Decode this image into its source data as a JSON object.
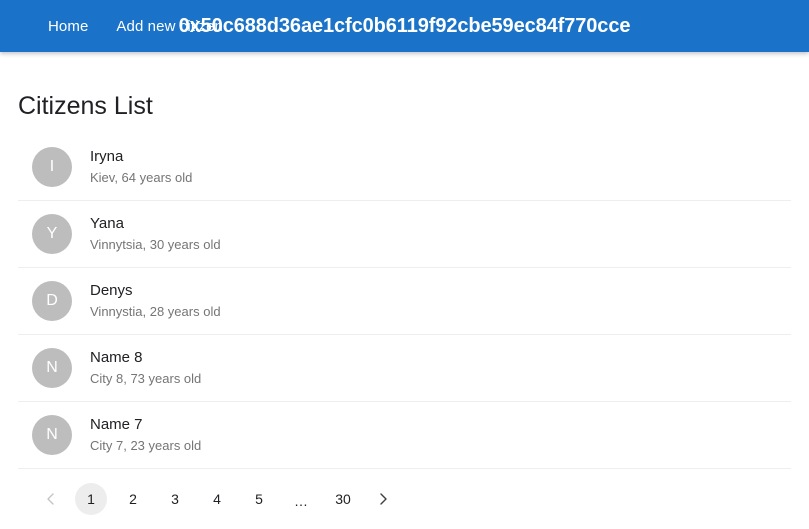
{
  "appbar": {
    "background_color": "#1a73c8",
    "nav_items": [
      {
        "label": "Home",
        "name": "nav-link-home"
      },
      {
        "label": "Add new citizen",
        "name": "nav-link-add-new-citizen"
      }
    ],
    "wallet_address": "0x50c688d36ae1cfc0b6119f92cbe59ec84f770cce"
  },
  "main": {
    "page_title": "Citizens List",
    "citizens": [
      {
        "initial": "I",
        "name": "Iryna",
        "meta": "Kiev, 64 years old"
      },
      {
        "initial": "Y",
        "name": "Yana",
        "meta": "Vinnytsia, 30 years old"
      },
      {
        "initial": "D",
        "name": "Denys",
        "meta": "Vinnystia, 28 years old"
      },
      {
        "initial": "N",
        "name": "Name 8",
        "meta": "City 8, 73 years old"
      },
      {
        "initial": "N",
        "name": "Name 7",
        "meta": "City 7, 23 years old"
      }
    ]
  },
  "pagination": {
    "prev_icon": "chevron-left-icon",
    "next_icon": "chevron-right-icon",
    "prev_enabled": false,
    "next_enabled": true,
    "current_page": 1,
    "total_pages": 30,
    "pages": [
      {
        "label": "1",
        "selected": true,
        "kind": "page"
      },
      {
        "label": "2",
        "selected": false,
        "kind": "page"
      },
      {
        "label": "3",
        "selected": false,
        "kind": "page"
      },
      {
        "label": "4",
        "selected": false,
        "kind": "page"
      },
      {
        "label": "5",
        "selected": false,
        "kind": "page"
      },
      {
        "label": "…",
        "selected": false,
        "kind": "ellipsis"
      },
      {
        "label": "30",
        "selected": false,
        "kind": "page"
      }
    ]
  },
  "colors": {
    "accent": "#1a73c8",
    "avatar": "#bdbdbd",
    "divider": "#eeeeee",
    "selected_page": "#ededed",
    "muted_text": "#757575"
  }
}
